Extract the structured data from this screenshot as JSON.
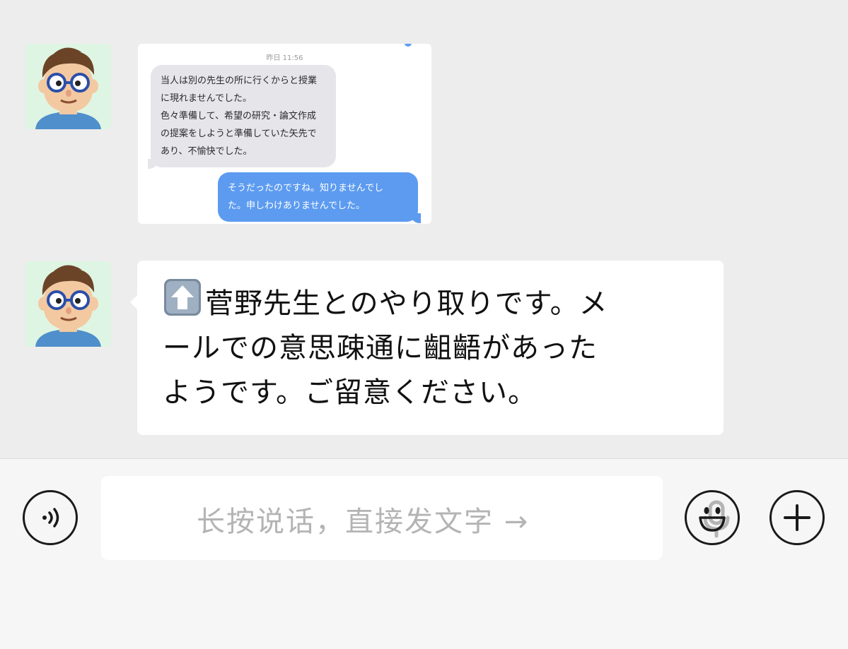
{
  "messages": [
    {
      "type": "image",
      "screenshot": {
        "time": "昨日 11:56",
        "received_lines": [
          "当人は別の先生の所に行くからと授業",
          "に現れませんでした。",
          "色々準備して、希望の研究・論文作成",
          "の提案をしようと準備していた矢先で",
          "あり、不愉快でした。"
        ],
        "sent_lines": [
          "そうだったのですね。知りませんでし",
          "た。申しわけありませんでした。"
        ]
      }
    },
    {
      "type": "text",
      "emoji": "up-arrow-emoji",
      "lines": [
        "菅野先生とのやり取りです。メ",
        "ールでの意思疎通に齟齬があった",
        "ようです。ご留意ください。"
      ]
    }
  ],
  "input_bar": {
    "placeholder": "长按说话，直接发文字 →",
    "voice_icon": "voice-icon",
    "mic_icon": "microphone-icon",
    "emoji_icon": "smiley-icon",
    "plus_icon": "plus-icon"
  },
  "colors": {
    "background": "#ededed",
    "bubble": "#ffffff",
    "received": "#e5e5ea",
    "sent": "#5c9bf0",
    "placeholder": "#b4b4b4"
  }
}
